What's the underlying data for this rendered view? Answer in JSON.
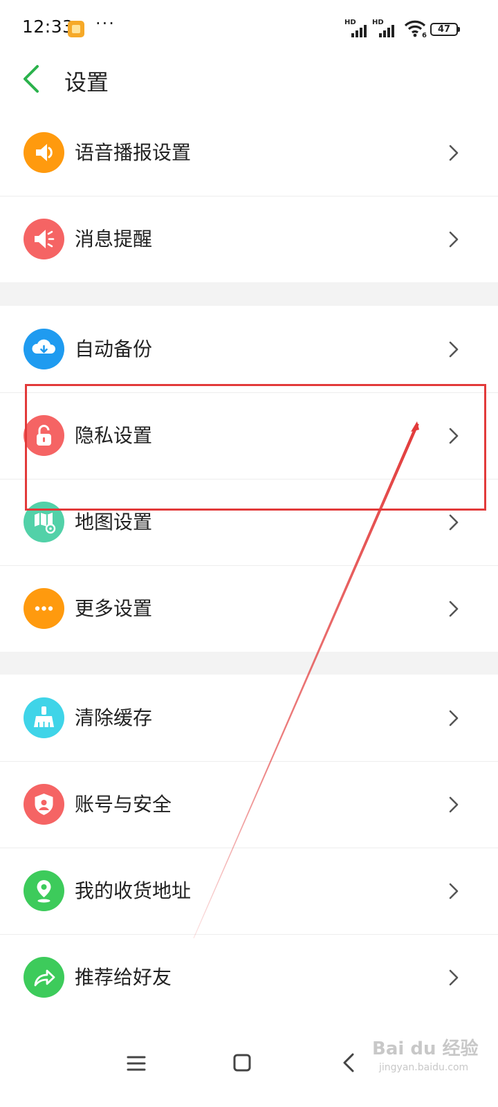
{
  "status_bar": {
    "time": "12:33",
    "dots": "···",
    "signal_1_label": "HD",
    "signal_2_label": "HD",
    "wifi_badge": "6",
    "battery": "47"
  },
  "header": {
    "title": "设置",
    "back_icon": "chevron-left-icon"
  },
  "sections": [
    {
      "items": [
        {
          "label": "语音播报设置",
          "icon": "speaker-icon",
          "color": "#ff9a0e"
        },
        {
          "label": "消息提醒",
          "icon": "megaphone-icon",
          "color": "#f56464"
        }
      ]
    },
    {
      "items": [
        {
          "label": "自动备份",
          "icon": "cloud-download-icon",
          "color": "#1f9bf0"
        },
        {
          "label": "隐私设置",
          "icon": "lock-icon",
          "color": "#f56464"
        },
        {
          "label": "地图设置",
          "icon": "map-gear-icon",
          "color": "#52d1a8"
        },
        {
          "label": "更多设置",
          "icon": "more-icon",
          "color": "#ff9a0e"
        }
      ]
    },
    {
      "items": [
        {
          "label": "清除缓存",
          "icon": "broom-icon",
          "color": "#3fd4e8"
        },
        {
          "label": "账号与安全",
          "icon": "shield-user-icon",
          "color": "#f56464"
        },
        {
          "label": "我的收货地址",
          "icon": "location-pin-icon",
          "color": "#3dcb5b"
        },
        {
          "label": "推荐给好友",
          "icon": "share-arrow-icon",
          "color": "#3dcb5b"
        }
      ]
    }
  ],
  "nav_bar": {
    "menu_icon": "menu-icon",
    "home_icon": "home-square-icon",
    "back_icon": "back-triangle-icon"
  },
  "watermark": {
    "brand": "Bai du 经验",
    "url": "jingyan.baidu.com"
  },
  "colors": {
    "accent_green": "#2bb24c",
    "annotation_red": "#e23a3a",
    "divider": "#f3f3f3"
  }
}
